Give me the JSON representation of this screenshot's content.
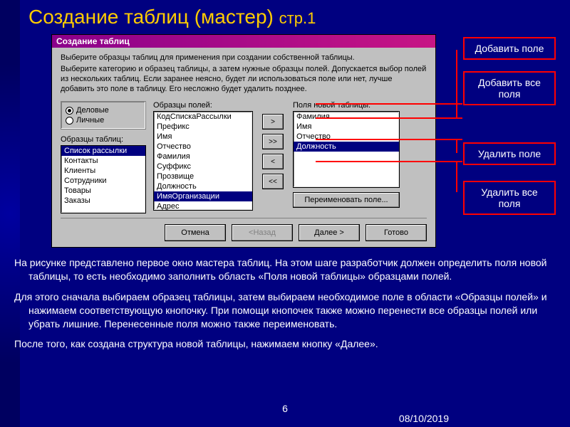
{
  "slide": {
    "title_main": "Создание таблиц (мастер)",
    "title_page": "стр.1",
    "number": "6",
    "date": "08/10/2019"
  },
  "dialog": {
    "title": "Создание таблиц",
    "instr1": "Выберите образцы таблиц для применения при создании собственной таблицы.",
    "instr2": "Выберите категорию и образец таблицы, а затем нужные образцы полей. Допускается выбор полей из нескольких таблиц. Если заранее неясно, будет ли использоваться поле или нет, лучше добавить это поле в таблицу. Его несложно будет удалить позднее.",
    "radios": {
      "business": "Деловые",
      "personal": "Личные"
    },
    "labels": {
      "templates": "Образцы таблиц:",
      "fields": "Образцы полей:",
      "newfields": "Поля новой таблицы:"
    },
    "templates": [
      "Список рассылки",
      "Контакты",
      "Клиенты",
      "Сотрудники",
      "Товары",
      "Заказы"
    ],
    "template_selected": 0,
    "sample_fields": [
      "КодСпискаРассылки",
      "Префикс",
      "Имя",
      "Отчество",
      "Фамилия",
      "Суффикс",
      "Прозвище",
      "Должность",
      "ИмяОрганизации",
      "Адрес"
    ],
    "sample_selected": 8,
    "new_fields": [
      "Фамилия",
      "Имя",
      "Отчество",
      "Должность"
    ],
    "new_selected": 3,
    "transfer": {
      "add": ">",
      "addall": ">>",
      "remove": "<",
      "removeall": "<<"
    },
    "rename": "Переименовать поле...",
    "buttons": {
      "cancel": "Отмена",
      "back": "<Назад",
      "next": "Далее >",
      "finish": "Готово"
    }
  },
  "callouts": {
    "add_field": "Добавить поле",
    "add_all": "Добавить все поля",
    "remove_field": "Удалить поле",
    "remove_all": "Удалить все поля"
  },
  "explain": {
    "p1": "На рисунке представлено первое окно мастера таблиц. На этом шаге разработчик должен определить поля новой таблицы, то есть необходимо заполнить область «Поля новой таблицы» образцами полей.",
    "p2": "Для этого сначала выбираем образец таблицы, затем выбираем необходимое поле в области «Образцы полей» и нажимаем соответствующую кнопочку. При помощи кнопочек также можно перенести все образцы полей или убрать лишние. Перенесенные поля можно также переименовать.",
    "p3": "После того, как создана структура новой таблицы, нажимаем кнопку «Далее»."
  }
}
